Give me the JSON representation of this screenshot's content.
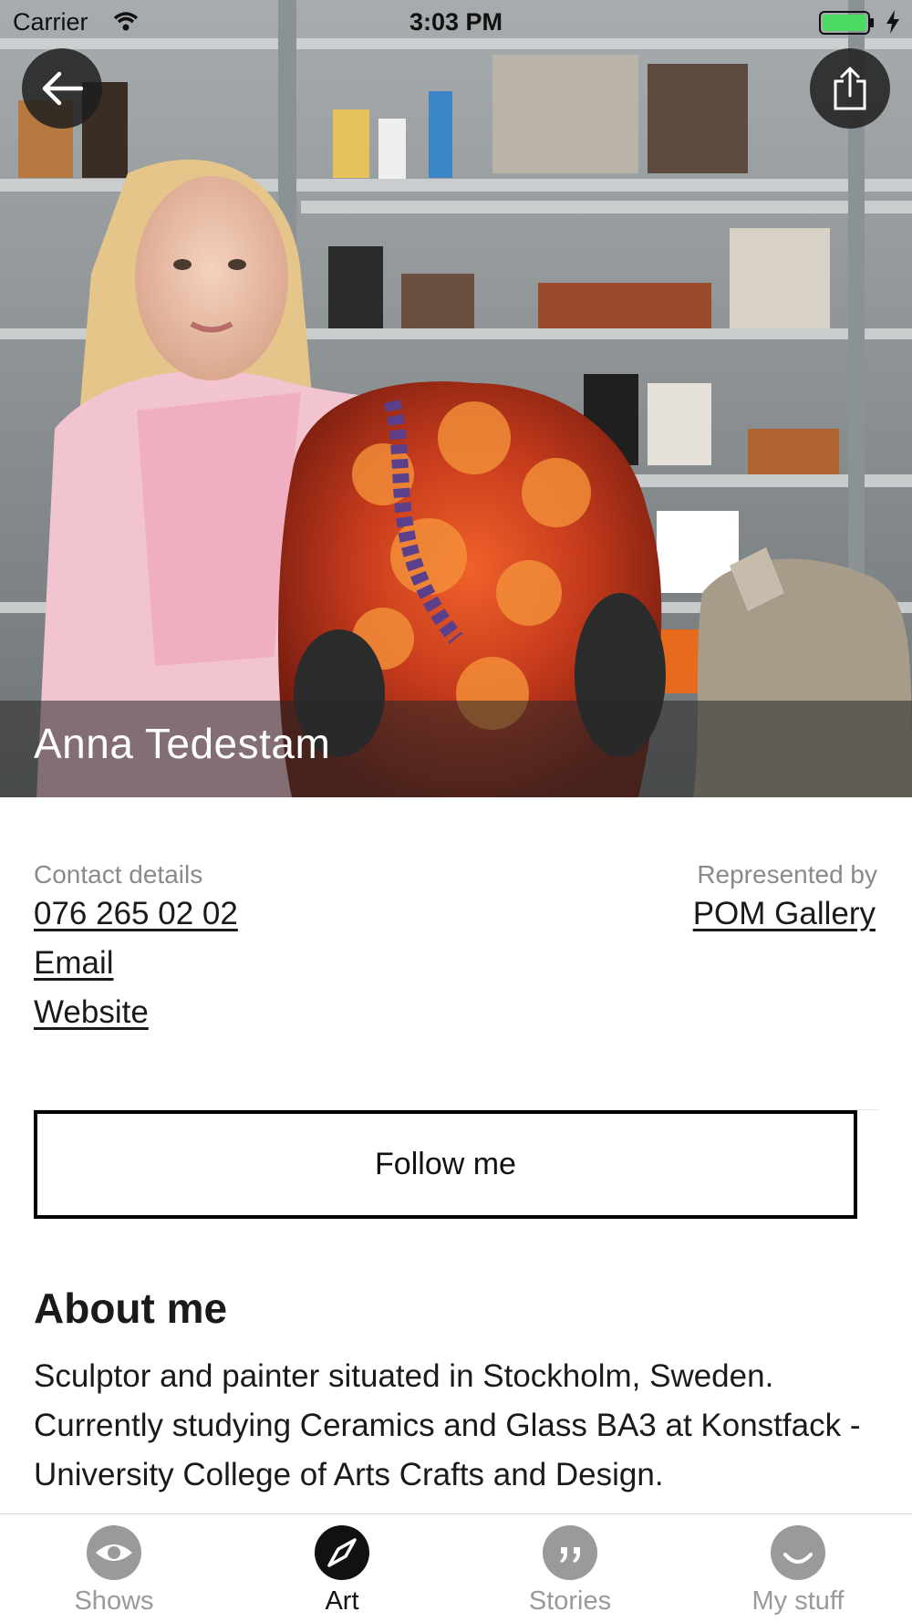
{
  "status_bar": {
    "carrier": "Carrier",
    "time": "3:03 PM",
    "battery_color": "#4cd964"
  },
  "hero": {
    "artist_name": "Anna Tedestam",
    "back_icon": "arrow-left-icon",
    "share_icon": "share-icon"
  },
  "contact": {
    "label": "Contact details",
    "phone": "076 265 02 02",
    "email": "Email",
    "website": "Website"
  },
  "representation": {
    "label": "Represented by",
    "gallery": "POM Gallery"
  },
  "follow_button": {
    "label": "Follow me"
  },
  "about": {
    "title": "About me",
    "text": "Sculptor and painter situated in Stockholm, Sweden. Currently studying Ceramics and Glass BA3 at Konstfack - University College of Arts Crafts and Design."
  },
  "tab_bar": {
    "tabs": [
      {
        "label": "Shows",
        "icon": "eye-icon",
        "active": false
      },
      {
        "label": "Art",
        "icon": "compass-icon",
        "active": true
      },
      {
        "label": "Stories",
        "icon": "quote-icon",
        "active": false
      },
      {
        "label": "My stuff",
        "icon": "smiley-icon",
        "active": false
      }
    ],
    "active_color": "#111111",
    "inactive_color": "#9a9a9a"
  }
}
